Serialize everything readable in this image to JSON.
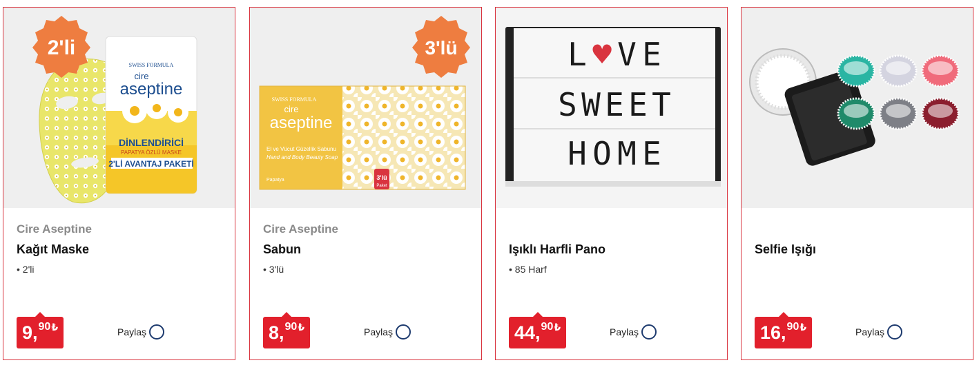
{
  "colors": {
    "card_border": "#d9343f",
    "price_bg": "#e2202c",
    "qty_badge": "#ee7d40",
    "share_icon": "#1d3a6e",
    "brand_text": "#8a8a8a"
  },
  "products": [
    {
      "brand": "Cire Aseptine",
      "title": "Kağıt Maske",
      "feature": "2'li",
      "qty_badge": "2'li",
      "package_brand_top": "SWISS FORMULA",
      "package_brand_small": "cire",
      "package_brand": "aseptine",
      "package_line1": "DİNLENDİRİCİ",
      "package_line2": "PAPATYA ÖZLÜ MASKE",
      "package_line3": "2'Lİ AVANTAJ PAKETİ",
      "price_int": "9,",
      "price_dec": "90",
      "currency": "₺",
      "share_label": "Paylaş"
    },
    {
      "brand": "Cire Aseptine",
      "title": "Sabun",
      "feature": "3'lü",
      "qty_badge": "3'lü",
      "package_brand_top": "SWISS FORMULA",
      "package_brand_small": "cire",
      "package_brand": "aseptine",
      "package_line1": "El ve Vücut Güzellik Sabunu",
      "package_line2": "Hand and Body Beauty Soap",
      "package_line3": "Papatya",
      "package_tag": "3'lü",
      "package_tag2": "Paket",
      "price_int": "8,",
      "price_dec": "90",
      "currency": "₺",
      "share_label": "Paylaş"
    },
    {
      "brand": "",
      "title": "Işıklı Harfli Pano",
      "feature": "85 Harf",
      "board_line1": [
        "L",
        "♥",
        "V",
        "E"
      ],
      "board_line2": [
        "S",
        "W",
        "E",
        "E",
        "T"
      ],
      "board_line3": [
        "H",
        "O",
        "M",
        "E"
      ],
      "price_int": "44,",
      "price_dec": "90",
      "currency": "₺",
      "share_label": "Paylaş"
    },
    {
      "brand": "",
      "title": "Selfie Işığı",
      "feature": "",
      "ring_colors": [
        "#ffffff",
        "#2ab5a3",
        "#d4d4e0",
        "#f06b7b",
        "#1f8a6a",
        "#7d7f86",
        "#8b1e2e"
      ],
      "price_int": "16,",
      "price_dec": "90",
      "currency": "₺",
      "share_label": "Paylaş"
    }
  ]
}
